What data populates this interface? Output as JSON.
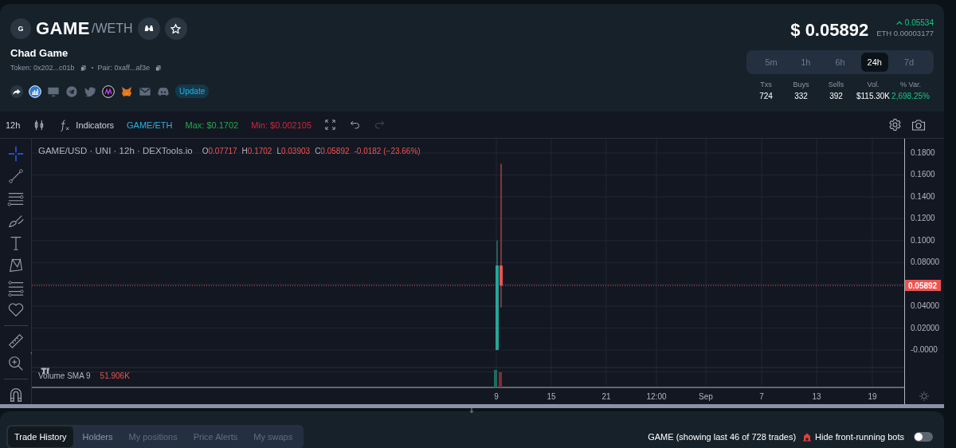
{
  "header": {
    "logo_letter": "G",
    "symbol": "GAME",
    "quote": "/WETH",
    "name": "Chad Game",
    "token": "Token: 0x202...c01b",
    "pair": "Pair: 0xaff...af3e",
    "update": "Update",
    "price": "$ 0.05892",
    "change": "0.05534",
    "eth_price": "ETH 0.00003177"
  },
  "periods": [
    {
      "label": "5m",
      "selected": false
    },
    {
      "label": "1h",
      "selected": false
    },
    {
      "label": "6h",
      "selected": false
    },
    {
      "label": "24h",
      "selected": true
    },
    {
      "label": "7d",
      "selected": false
    }
  ],
  "stats": [
    {
      "label": "Txs",
      "value": "724",
      "kind": "plain"
    },
    {
      "label": "Buys",
      "value": "332",
      "kind": "plain"
    },
    {
      "label": "Sells",
      "value": "392",
      "kind": "plain"
    },
    {
      "label": "Vol.",
      "value": "$115.30K",
      "kind": "plain"
    },
    {
      "label": "% Var.",
      "value": "2,698.25%",
      "kind": "positive"
    }
  ],
  "toolbar": {
    "interval": "12h",
    "indicators": "Indicators",
    "pair": "GAME/ETH",
    "max": "Max: $0.1702",
    "min": "Min: $0.002105"
  },
  "legend": {
    "title": "GAME/USD · UNI · 12h · DEXTools.io",
    "ohlc": [
      {
        "key": "O",
        "value": "0.07717"
      },
      {
        "key": "H",
        "value": "0.1702"
      },
      {
        "key": "L",
        "value": "0.03903"
      },
      {
        "key": "C",
        "value": "0.05892"
      }
    ],
    "change": "-0.0182 (−23.66%)"
  },
  "y_axis": [
    "0.1800",
    "0.1600",
    "0.1400",
    "0.1200",
    "0.1000",
    "0.08000",
    "0.04000",
    "0.02000",
    "-0.0000"
  ],
  "last_price": "0.05892",
  "volume": {
    "label": "Volume SMA 9",
    "value": "51.906K"
  },
  "x_axis": [
    "9",
    "15",
    "21",
    "12:00",
    "Sep",
    "7",
    "13",
    "19"
  ],
  "tabs": [
    {
      "label": "Trade History",
      "selected": true
    },
    {
      "label": "Holders",
      "selected": false
    },
    {
      "label": "My positions",
      "selected": false
    },
    {
      "label": "Price Alerts",
      "selected": false
    },
    {
      "label": "My swaps",
      "selected": false
    }
  ],
  "trades_info": "GAME (showing last 46 of 728 trades)",
  "hide_bots": {
    "label": "Hide front-running bots",
    "on": false
  }
}
